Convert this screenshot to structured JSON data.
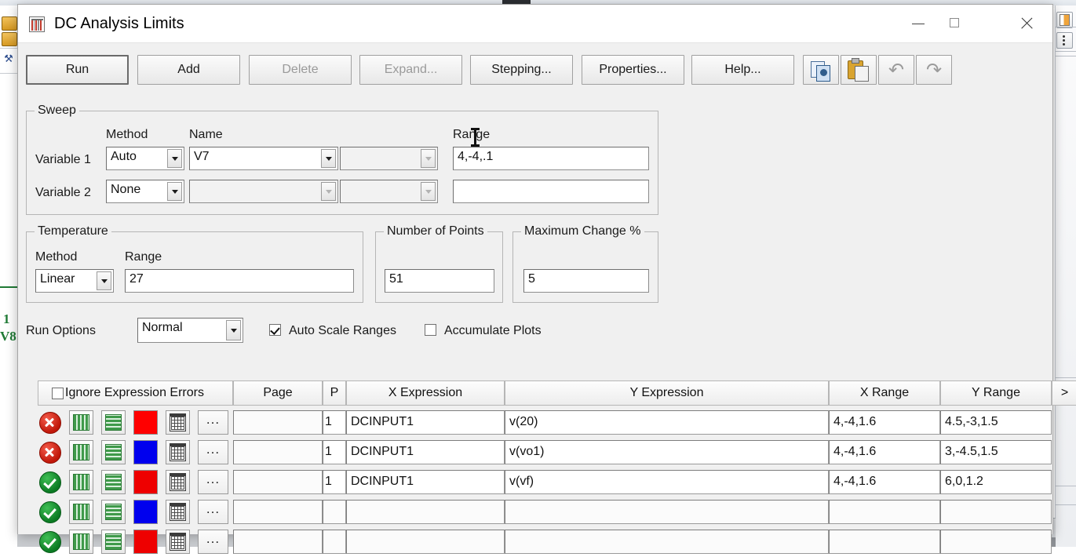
{
  "window": {
    "title": "DC Analysis Limits",
    "icon": "analysis-limits-icon",
    "minimize_label": "Minimize",
    "maximize_label": "Maximize",
    "close_label": "Close"
  },
  "toolbar": {
    "buttons": [
      {
        "label": "Run",
        "enabled": true,
        "default": true
      },
      {
        "label": "Add",
        "enabled": true,
        "default": false
      },
      {
        "label": "Delete",
        "enabled": false,
        "default": false
      },
      {
        "label": "Expand...",
        "enabled": false,
        "default": false
      },
      {
        "label": "Stepping...",
        "enabled": true,
        "default": false
      },
      {
        "label": "Properties...",
        "enabled": true,
        "default": false
      },
      {
        "label": "Help...",
        "enabled": true,
        "default": false
      }
    ],
    "icon_buttons": [
      {
        "name": "copy-icon",
        "tooltip": "Copy"
      },
      {
        "name": "paste-icon",
        "tooltip": "Paste"
      },
      {
        "name": "undo-icon",
        "tooltip": "Undo",
        "glyph": "↶",
        "enabled": false
      },
      {
        "name": "redo-icon",
        "tooltip": "Redo",
        "glyph": "↷",
        "enabled": false
      }
    ]
  },
  "sweep": {
    "legend": "Sweep",
    "col_method": "Method",
    "col_name": "Name",
    "col_range": "Range",
    "var1_label": "Variable 1",
    "var1_method": "Auto",
    "var1_name": "V7",
    "var1_extra": "",
    "var1_range": "4,-4,.1",
    "var2_label": "Variable 2",
    "var2_method": "None",
    "var2_name": "",
    "var2_extra": "",
    "var2_range": ""
  },
  "temperature": {
    "legend": "Temperature",
    "method_label": "Method",
    "range_label": "Range",
    "method": "Linear",
    "range": "27"
  },
  "number_of_points": {
    "legend": "Number of Points",
    "value": "51"
  },
  "maximum_change": {
    "legend": "Maximum Change %",
    "value": "5"
  },
  "run_options": {
    "label": "Run Options",
    "value": "Normal",
    "auto_scale_label": "Auto Scale Ranges",
    "auto_scale_checked": true,
    "accumulate_label": "Accumulate Plots",
    "accumulate_checked": false
  },
  "table": {
    "ignore_errors_label": "Ignore Expression Errors",
    "ignore_errors_checked": false,
    "headers": {
      "page": "Page",
      "p": "P",
      "x_expression": "X Expression",
      "y_expression": "Y Expression",
      "x_range": "X Range",
      "y_range": "Y Range",
      "more": ">"
    },
    "rows": [
      {
        "status": "error",
        "color": "#ff0000",
        "page": "",
        "p": "1",
        "x_expression": "DCINPUT1",
        "y_expression": "v(20)",
        "x_range": "4,-4,1.6",
        "y_range": "4.5,-3,1.5",
        "ellipsis": "..."
      },
      {
        "status": "error",
        "color": "#0000ee",
        "page": "",
        "p": "1",
        "x_expression": "DCINPUT1",
        "y_expression": "v(vo1)",
        "x_range": "4,-4,1.6",
        "y_range": "3,-4.5,1.5",
        "ellipsis": "..."
      },
      {
        "status": "ok",
        "color": "#ee0000",
        "page": "",
        "p": "1",
        "x_expression": "DCINPUT1",
        "y_expression": "v(vf)",
        "x_range": "4,-4,1.6",
        "y_range": "6,0,1.2",
        "ellipsis": "..."
      },
      {
        "status": "ok",
        "color": "#0000ee",
        "page": "",
        "p": "",
        "x_expression": "",
        "y_expression": "",
        "x_range": "",
        "y_range": "",
        "ellipsis": "..."
      },
      {
        "status": "ok",
        "color": "#ee0000",
        "page": "",
        "p": "",
        "x_expression": "",
        "y_expression": "",
        "x_range": "",
        "y_range": "",
        "ellipsis": "..."
      }
    ]
  },
  "background": {
    "wire_number": "1",
    "wire_label": "V8"
  },
  "colors": {
    "dialog_face": "#f0f0f0",
    "titlebar": "#ffffff",
    "field_bg": "#ffffff",
    "error_red": "#c0170a",
    "ok_green": "#0b7a23"
  }
}
